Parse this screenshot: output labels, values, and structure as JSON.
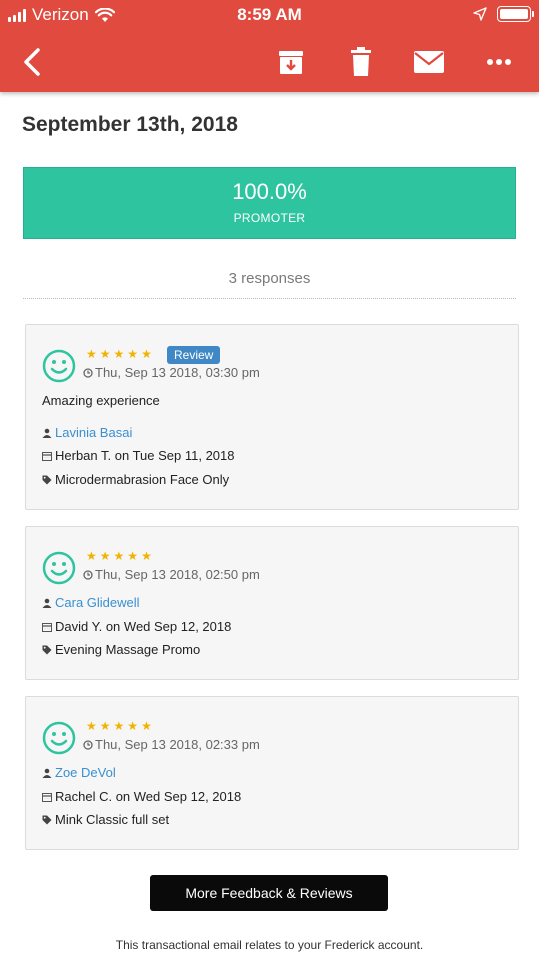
{
  "status_bar": {
    "carrier": "Verizon",
    "time": "8:59 AM"
  },
  "toolbar": {
    "back_icon": "chevron-left-icon",
    "archive_icon": "archive-icon",
    "delete_icon": "trash-icon",
    "mail_icon": "mail-icon",
    "more_icon": "more-horizontal-icon"
  },
  "heading": "September 13th, 2018",
  "nps": {
    "value": "100.0%",
    "label": "PROMOTER",
    "color": "#2ec4a0"
  },
  "responses_label": "3 responses",
  "reviews": [
    {
      "stars": 5,
      "badge": "Review",
      "timestamp": "Thu, Sep 13 2018, 03:30 pm",
      "comment": "Amazing experience",
      "customer": "Lavinia Basai",
      "appointment": "Herban T. on Tue Sep 11, 2018",
      "service": "Microdermabrasion Face Only"
    },
    {
      "stars": 5,
      "timestamp": "Thu, Sep 13 2018, 02:50 pm",
      "customer": "Cara Glidewell",
      "appointment": "David Y. on Wed Sep 12, 2018",
      "service": "Evening Massage Promo"
    },
    {
      "stars": 5,
      "timestamp": "Thu, Sep 13 2018, 02:33 pm",
      "customer": "Zoe DeVol",
      "appointment": "Rachel C. on Wed Sep 12, 2018",
      "service": "Mink Classic full set"
    }
  ],
  "more_button": "More Feedback & Reviews",
  "footer_text": "This transactional email relates to your Frederick account.",
  "colors": {
    "header": "#e04a3f",
    "accent": "#2ec4a0",
    "link": "#3a8fd0",
    "star": "#f0b400",
    "badge": "#3f88c5"
  }
}
